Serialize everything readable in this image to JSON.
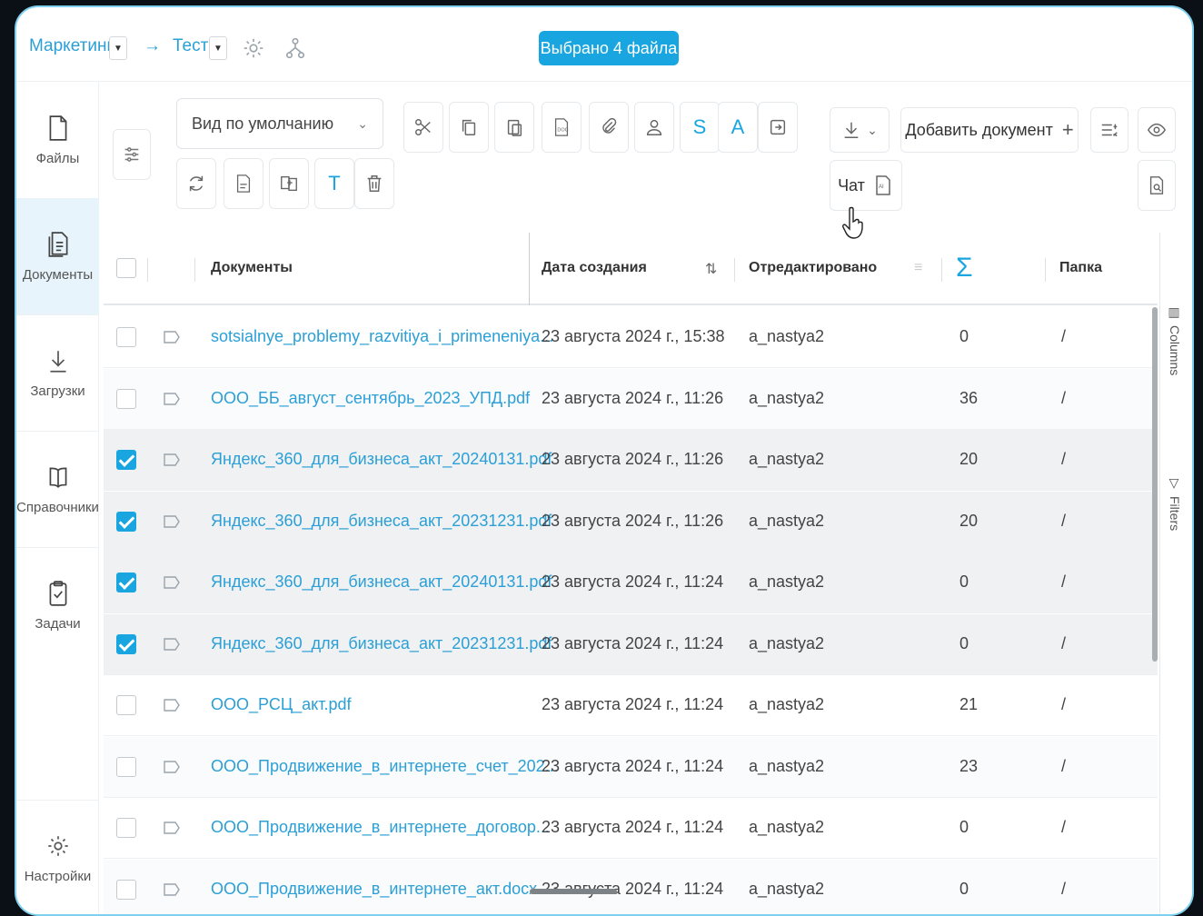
{
  "breadcrumb": {
    "workspace": "Маркетинг",
    "arrow": "→",
    "project": "Тест"
  },
  "selection_badge": "Выбрано 4 файла",
  "sidebar": {
    "items": [
      {
        "label": "Файлы",
        "icon": "file-icon"
      },
      {
        "label": "Документы",
        "icon": "document-icon",
        "active": true
      },
      {
        "label": "Загрузки",
        "icon": "download-icon"
      },
      {
        "label": "Справочники",
        "icon": "book-icon"
      },
      {
        "label": "Задачи",
        "icon": "clipboard-icon"
      },
      {
        "label": "Настройки",
        "icon": "gear-icon"
      }
    ]
  },
  "toolbar": {
    "view_select": "Вид по умолчанию",
    "add_document": "Добавить документ",
    "chat": "Чат",
    "s_label": "S",
    "a_label": "A",
    "t_label": "T"
  },
  "table": {
    "headers": {
      "documents": "Документы",
      "created": "Дата создания",
      "edited": "Отредактировано",
      "sum": "Σ",
      "folder": "Папка"
    },
    "rows": [
      {
        "name": "sotsialnye_problemy_razvitiya_i_primeneniya...",
        "date": "23 августа 2024 г., 15:38",
        "editor": "a_nastya2",
        "count": "0",
        "folder": "/",
        "checked": false
      },
      {
        "name": "ООО_ББ_август_сентябрь_2023_УПД.pdf",
        "date": "23 августа 2024 г., 11:26",
        "editor": "a_nastya2",
        "count": "36",
        "folder": "/",
        "checked": false
      },
      {
        "name": "Яндекс_360_для_бизнеса_акт_20240131.pdf",
        "date": "23 августа 2024 г., 11:26",
        "editor": "a_nastya2",
        "count": "20",
        "folder": "/",
        "checked": true
      },
      {
        "name": "Яндекс_360_для_бизнеса_акт_20231231.pdf",
        "date": "23 августа 2024 г., 11:26",
        "editor": "a_nastya2",
        "count": "20",
        "folder": "/",
        "checked": true
      },
      {
        "name": "Яндекс_360_для_бизнеса_акт_20240131.pdf",
        "date": "23 августа 2024 г., 11:24",
        "editor": "a_nastya2",
        "count": "0",
        "folder": "/",
        "checked": true
      },
      {
        "name": "Яндекс_360_для_бизнеса_акт_20231231.pdf",
        "date": "23 августа 2024 г., 11:24",
        "editor": "a_nastya2",
        "count": "0",
        "folder": "/",
        "checked": true
      },
      {
        "name": "ООО_РСЦ_акт.pdf",
        "date": "23 августа 2024 г., 11:24",
        "editor": "a_nastya2",
        "count": "21",
        "folder": "/",
        "checked": false
      },
      {
        "name": "ООО_Продвижение_в_интернете_счет_202...",
        "date": "23 августа 2024 г., 11:24",
        "editor": "a_nastya2",
        "count": "23",
        "folder": "/",
        "checked": false
      },
      {
        "name": "ООО_Продвижение_в_интернете_договор...",
        "date": "23 августа 2024 г., 11:24",
        "editor": "a_nastya2",
        "count": "0",
        "folder": "/",
        "checked": false
      },
      {
        "name": "ООО_Продвижение_в_интернете_акт.docx",
        "date": "23 августа 2024 г., 11:24",
        "editor": "a_nastya2",
        "count": "0",
        "folder": "/",
        "checked": false
      }
    ]
  },
  "side_panel": {
    "columns": "Columns",
    "filters": "Filters"
  },
  "colors": {
    "accent": "#19a6e0",
    "link": "#2b9fd6",
    "active_nav": "#e7f4fb"
  }
}
